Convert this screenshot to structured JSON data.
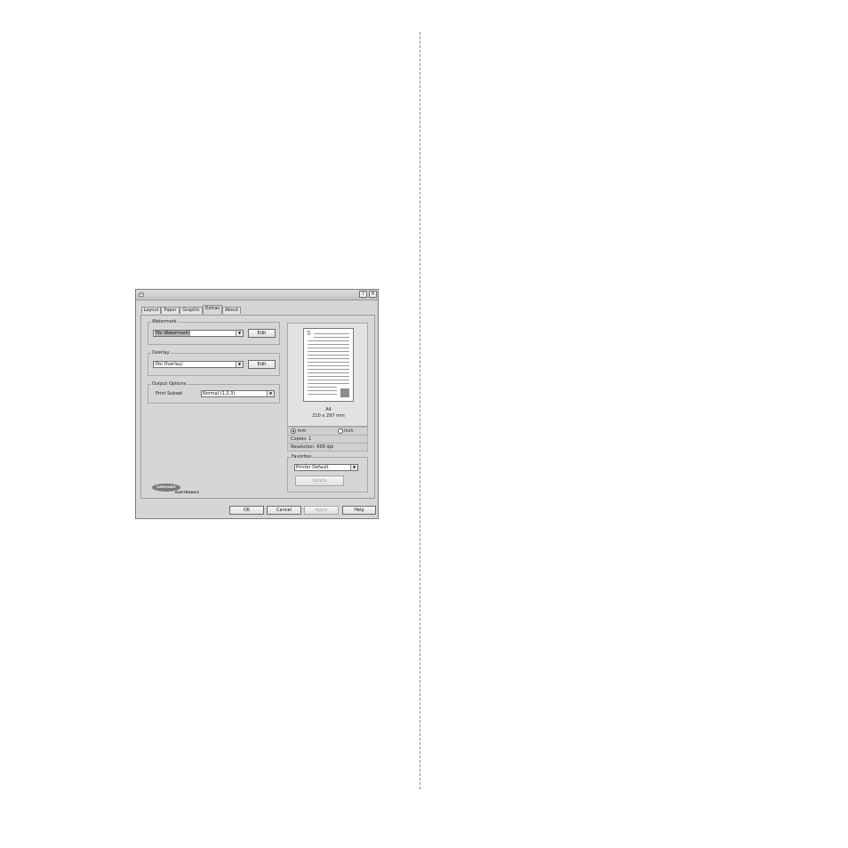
{
  "window": {
    "title_icon": "printer-icon",
    "help_button": "?",
    "close_button": "✕"
  },
  "tabs": [
    {
      "label": "Layout",
      "active": false
    },
    {
      "label": "Paper",
      "active": false
    },
    {
      "label": "Graphic",
      "active": false
    },
    {
      "label": "Extras",
      "active": true
    },
    {
      "label": "About",
      "active": false
    }
  ],
  "watermark": {
    "group_label": "Watermark",
    "selected": "(No Watermark)",
    "edit_label": "Edit"
  },
  "overlay": {
    "group_label": "Overlay",
    "selected": "(No Overlay)",
    "edit_label": "Edit"
  },
  "output_options": {
    "group_label": "Output Options",
    "print_subset_label": "Print Subset",
    "print_subset_value": "Normal (1,2,3)"
  },
  "preview": {
    "paper_name": "A4",
    "paper_size": "210 x 297 mm",
    "unit_mm_label": "mm",
    "unit_inch_label": "inch",
    "selected_unit": "mm",
    "copies": "Copies: 1",
    "resolution": "Resolution: 600 dpi",
    "thumb_letter": "S"
  },
  "favorites": {
    "group_label": "Favorites",
    "selected": "Printer Default",
    "delete_label": "Delete"
  },
  "logo": {
    "brand": "SAMSUNG",
    "sub": "ELECTRONICS"
  },
  "footer": {
    "ok_label": "OK",
    "cancel_label": "Cancel",
    "apply_label": "Apply",
    "help_label": "Help"
  },
  "colors": {
    "dialog_bg": "#d6d6d6",
    "border": "#7b7b7b"
  }
}
